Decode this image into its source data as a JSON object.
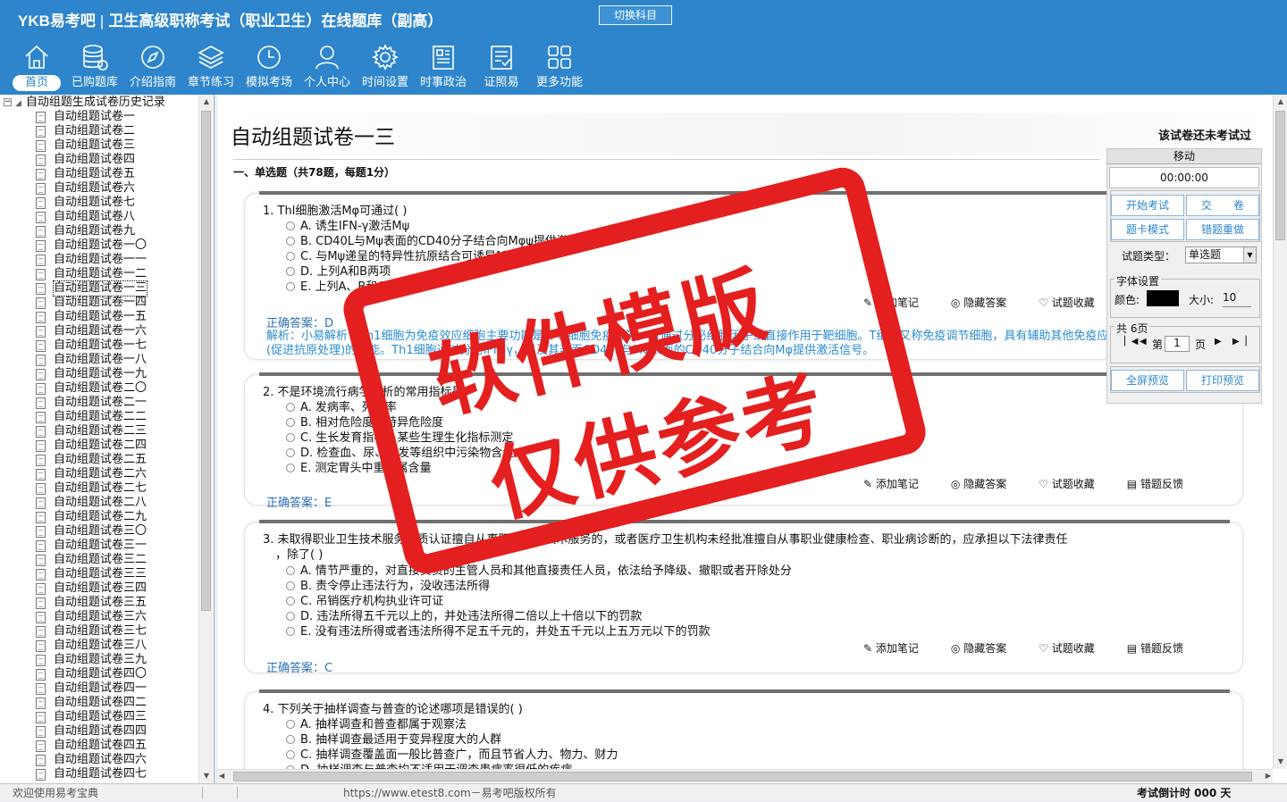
{
  "app": {
    "logo": "YKB易考吧",
    "title": "卫生高级职称考试（职业卫生）在线题库（副高）",
    "switch_subject": "切换科目"
  },
  "toolbar": [
    {
      "label": "首页",
      "icon": "home-icon"
    },
    {
      "label": "已购题库",
      "icon": "database-icon"
    },
    {
      "label": "介绍指南",
      "icon": "compass-icon"
    },
    {
      "label": "章节练习",
      "icon": "layers-icon"
    },
    {
      "label": "模拟考场",
      "icon": "clock-icon"
    },
    {
      "label": "个人中心",
      "icon": "user-icon"
    },
    {
      "label": "时间设置",
      "icon": "gear-icon"
    },
    {
      "label": "时事政治",
      "icon": "news-icon"
    },
    {
      "label": "证照易",
      "icon": "certificate-icon"
    },
    {
      "label": "更多功能",
      "icon": "grid-icon"
    }
  ],
  "tree": {
    "root": "自动组题生成试卷历史记录",
    "items": [
      "自动组题试卷一",
      "自动组题试卷二",
      "自动组题试卷三",
      "自动组题试卷四",
      "自动组题试卷五",
      "自动组题试卷六",
      "自动组题试卷七",
      "自动组题试卷八",
      "自动组题试卷九",
      "自动组题试卷一〇",
      "自动组题试卷一一",
      "自动组题试卷一二",
      "自动组题试卷一三",
      "自动组题试卷一四",
      "自动组题试卷一五",
      "自动组题试卷一六",
      "自动组题试卷一七",
      "自动组题试卷一八",
      "自动组题试卷一九",
      "自动组题试卷二〇",
      "自动组题试卷二一",
      "自动组题试卷二二",
      "自动组题试卷二三",
      "自动组题试卷二四",
      "自动组题试卷二五",
      "自动组题试卷二六",
      "自动组题试卷二七",
      "自动组题试卷二八",
      "自动组题试卷二九",
      "自动组题试卷三〇",
      "自动组题试卷三一",
      "自动组题试卷三二",
      "自动组题试卷三三",
      "自动组题试卷三四",
      "自动组题试卷三五",
      "自动组题试卷三六",
      "自动组题试卷三七",
      "自动组题试卷三八",
      "自动组题试卷三九",
      "自动组题试卷四〇",
      "自动组题试卷四一",
      "自动组题试卷四二",
      "自动组题试卷四三",
      "自动组题试卷四四",
      "自动组题试卷四五",
      "自动组题试卷四六",
      "自动组题试卷四七"
    ],
    "selected_index": 12
  },
  "paper": {
    "title": "自动组题试卷一三",
    "status": "该试卷还未考试过",
    "section": "一、单选题（共78题，每题1分）"
  },
  "actions": {
    "note": "添加笔记",
    "hide": "隐藏答案",
    "fav": "试题收藏",
    "report": "错题反馈"
  },
  "questions": [
    {
      "title": "1. Thl细胞激活Mφ可通过( )",
      "options": [
        "A. 诱生IFN-γ激活Mψ",
        "B. CD40L与Mψ表面的CD40分子结合向Mφψ提供激活信号",
        "C. 与Mψ递呈的特异性抗原结合可诱导Mψ激活",
        "D. 上列A和B两项",
        "E. 上列A、B和C三项"
      ],
      "answer": "正确答案：D",
      "explain": "解析：小易解析：Th1细胞为免疫效应细胞主要功能是介导细胞免疫应答，可通过分泌细胞因子或直接作用于靶细胞。T细胞又称免疫调节细胞，具有辅助其他免疫应答(促进抗原处理)的功能。Th1细胞通过分泌IFN-γ，以及其表面CD40L与Mφ表面的CD40分子结合向Mφ提供激活信号。"
    },
    {
      "title": "2. 不是环境流行病学分析的常用指标是",
      "options": [
        "A. 发病率、死亡率",
        "B. 相对危险度、特异危险度",
        "C. 生长发育指标、某些生理生化指标测定",
        "D. 检查血、尿、头发等组织中污染物含量",
        "E. 测定胃头中重金属含量"
      ],
      "answer": "正确答案：E"
    },
    {
      "title": "3. 未取得职业卫生技术服务资质认证擅自从事职业卫生技术服务的，或者医疗卫生机构未经批准擅自从事职业健康检查、职业病诊断的，应承担以下法律责任",
      "title2": "，除了( )",
      "options": [
        "A. 情节严重的，对直接负责的主管人员和其他直接责任人员，依法给予降级、撤职或者开除处分",
        "B. 责令停止违法行为，没收违法所得",
        "C. 吊销医疗机构执业许可证",
        "D. 违法所得五千元以上的，并处违法所得二倍以上十倍以下的罚款",
        "E. 没有违法所得或者违法所得不足五千元的，并处五千元以上五万元以下的罚款"
      ],
      "answer": "正确答案：C"
    },
    {
      "title": "4. 下列关于抽样调查与普查的论述哪项是错误的( )",
      "options": [
        "A. 抽样调查和普查都属于观察法",
        "B. 抽样调查最适用于变异程度大的人群",
        "C. 抽样调查覆盖面一般比普查广，而且节省人力、物力、财力",
        "D. 抽样调查与普查均不适用于调查患病率很低的疾病"
      ]
    }
  ],
  "panel": {
    "head": "移动",
    "timer": "00:00:00",
    "start": "开始考试",
    "submit": "交　　卷",
    "card_mode": "题卡模式",
    "redo_wrong": "错题重做",
    "type_label": "试题类型：",
    "type_value": "单选题",
    "font_label": "字体设置",
    "color_label": "颜色:",
    "size_label": "大小:",
    "size_value": "10",
    "pages": "共 6页",
    "page_prefix": "第",
    "page_value": "1",
    "page_suffix": "页",
    "fullscreen": "全屏预览",
    "print": "打印预览"
  },
  "status": {
    "welcome": "欢迎使用易考宝典",
    "url": "https://www.etest8.com－易考吧版权所有",
    "countdown": "考试倒计时 000 天"
  },
  "stamp": {
    "line1": "软件模版",
    "line2": "仅供参考"
  }
}
